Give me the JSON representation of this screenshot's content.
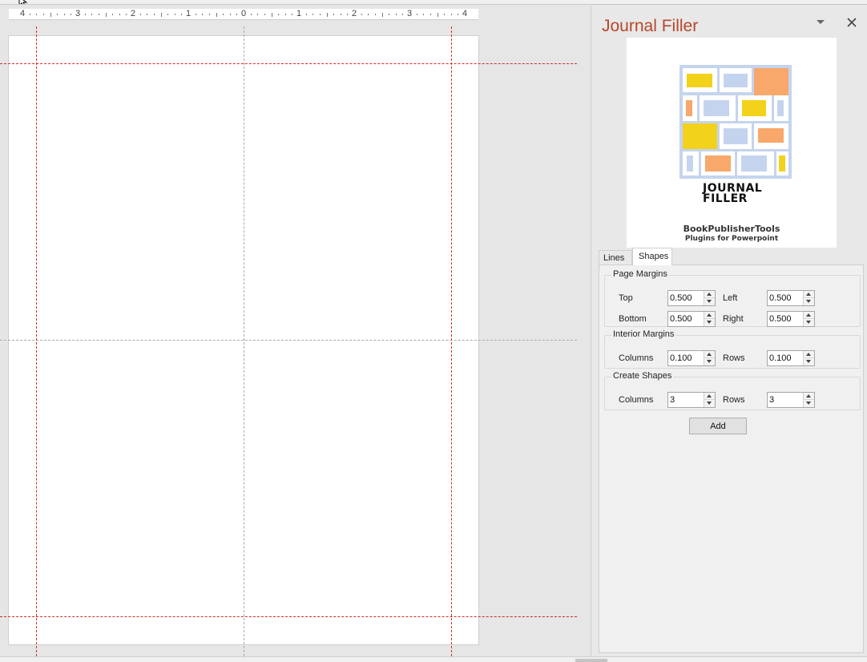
{
  "ruler": {
    "numbers": [
      "4",
      "3",
      "2",
      "1",
      "0",
      "1",
      "2",
      "3",
      "4"
    ]
  },
  "pane": {
    "title": "Journal Filler",
    "title_color": "#b7472a",
    "options_icon": "chevron-down-icon",
    "close_icon": "close-icon",
    "logo": {
      "title_line1": "JOURNAL",
      "title_line2": "FILLER",
      "brand": "BookPublisherTools",
      "tagline": "Plugins for Powerpoint",
      "colors": {
        "yellow": "#f2d21b",
        "blue": "#c5d4ee",
        "orange": "#f7a86a",
        "grid": "#c5d4ee"
      }
    },
    "tabs": [
      {
        "label": "Lines",
        "active": false
      },
      {
        "label": "Shapes",
        "active": true
      }
    ],
    "page_margins": {
      "title": "Page Margins",
      "top_label": "Top",
      "top_value": "0.500",
      "left_label": "Left",
      "left_value": "0.500",
      "bottom_label": "Bottom",
      "bottom_value": "0.500",
      "right_label": "Right",
      "right_value": "0.500"
    },
    "interior_margins": {
      "title": "Interior Margins",
      "columns_label": "Columns",
      "columns_value": "0.100",
      "rows_label": "Rows",
      "rows_value": "0.100"
    },
    "create_shapes": {
      "title": "Create Shapes",
      "columns_label": "Columns",
      "columns_value": "3",
      "rows_label": "Rows",
      "rows_value": "3"
    },
    "add_label": "Add"
  },
  "guides": {
    "margin_color": "#d42a2a",
    "center_color": "#a8a8a8"
  }
}
